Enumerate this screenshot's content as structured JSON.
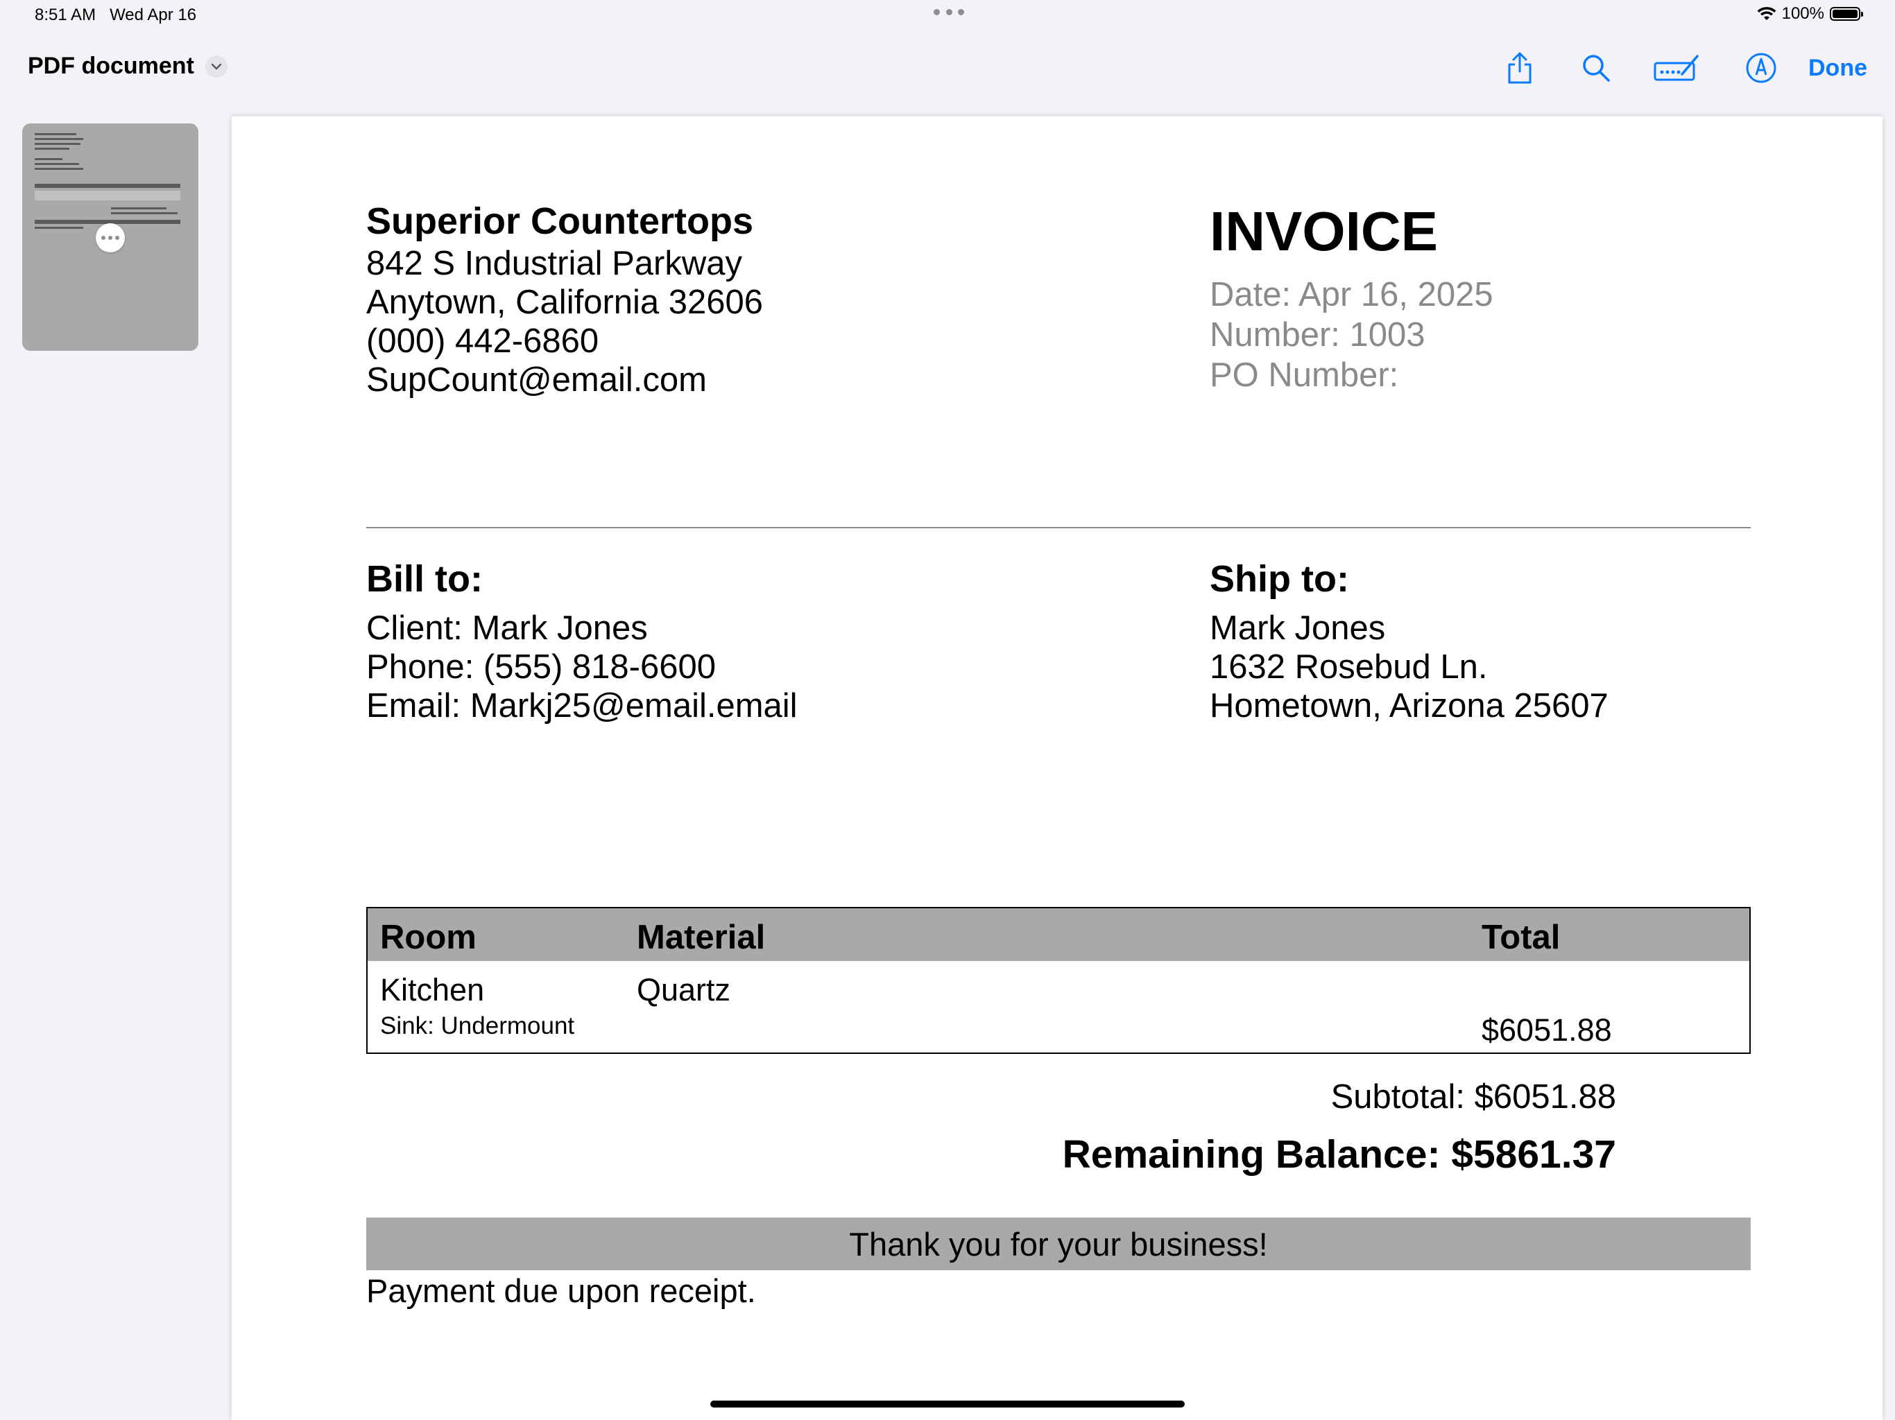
{
  "status_bar": {
    "time": "8:51 AM",
    "date": "Wed Apr 16",
    "battery": "100%",
    "battery_level": 1.0
  },
  "toolbar": {
    "title": "PDF document",
    "done_label": "Done",
    "icons": [
      "share-icon",
      "search-icon",
      "signature-icon",
      "markup-icon"
    ],
    "accent_color": "#0a7aff"
  },
  "invoice": {
    "company": {
      "name": "Superior Countertops",
      "address1": "842 S Industrial Parkway",
      "address2": "Anytown, California 32606",
      "phone": "(000) 442-6860",
      "email": "SupCount@email.com"
    },
    "title": "INVOICE",
    "date": "Date: Apr 16, 2025",
    "number": "Number: 1003",
    "po": "PO Number:",
    "bill_to": {
      "heading": "Bill to:",
      "client": "Client: Mark Jones",
      "phone": "Phone: (555) 818-6600",
      "email": "Email: Markj25@email.email"
    },
    "ship_to": {
      "heading": "Ship to:",
      "name": "Mark Jones",
      "street": "1632 Rosebud Ln.",
      "city": "Hometown, Arizona 25607"
    },
    "table": {
      "headers": [
        "Room",
        "Material",
        "Total"
      ],
      "rows": [
        {
          "room": "Kitchen",
          "material": "Quartz",
          "note": "Sink: Undermount",
          "total": "$6051.88"
        }
      ]
    },
    "subtotal": "Subtotal: $6051.88",
    "remaining_balance": "Remaining Balance: $5861.37",
    "thanks": "Thank you for your business!",
    "payment_terms": "Payment due upon receipt."
  }
}
